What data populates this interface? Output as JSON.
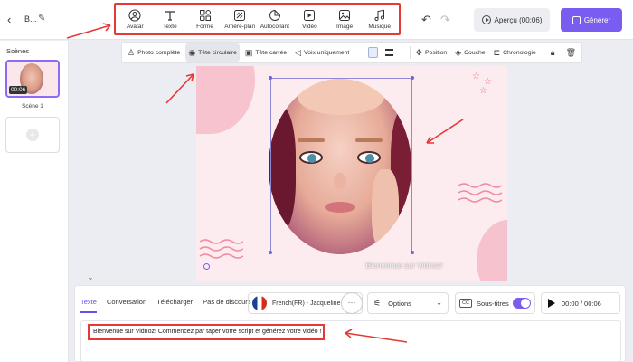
{
  "header": {
    "project_title": "B...",
    "tools": [
      {
        "label": "Avatar",
        "icon": "avatar-icon"
      },
      {
        "label": "Texte",
        "icon": "text-icon"
      },
      {
        "label": "Forme",
        "icon": "shape-icon"
      },
      {
        "label": "Arrière-plan",
        "icon": "background-icon"
      },
      {
        "label": "Autocollant",
        "icon": "sticker-icon"
      },
      {
        "label": "Vidéo",
        "icon": "video-icon"
      },
      {
        "label": "Image",
        "icon": "image-icon"
      },
      {
        "label": "Musique",
        "icon": "music-icon"
      }
    ],
    "preview_label": "Aperçu (00:06)",
    "generate_label": "Générer"
  },
  "sidebar": {
    "title": "Scènes",
    "scenes": [
      {
        "label": "Scène 1",
        "duration": "00:06"
      }
    ]
  },
  "subtoolbar": {
    "items": [
      {
        "label": "Photo complète",
        "active": false
      },
      {
        "label": "Tête circulaire",
        "active": true
      },
      {
        "label": "Tête carrée",
        "active": false
      },
      {
        "label": "Voix uniquement",
        "active": false
      }
    ],
    "position_label": "Position",
    "layer_label": "Couche",
    "timeline_label": "Chronologie"
  },
  "canvas": {
    "subtitle": "Bienvenue sur Vidnoz!"
  },
  "bottom_panel": {
    "tabs": [
      {
        "label": "Texte",
        "active": true
      },
      {
        "label": "Conversation",
        "active": false
      },
      {
        "label": "Télécharger",
        "active": false
      },
      {
        "label": "Pas de discours",
        "active": false
      }
    ],
    "voice": "French(FR) - Jacqueline",
    "options_label": "Options",
    "subtitles_label": "Sous-titres",
    "subtitles_cc": "CC",
    "subtitles_enabled": true,
    "time": "00:00 / 00:06",
    "script_text": "Bienvenue sur Vidnoz! Commencez par taper votre script et générez votre vidéo !"
  },
  "colors": {
    "accent": "#7b5cf0",
    "annotation_red": "#e53935",
    "canvas_bg": "#fcebef"
  }
}
